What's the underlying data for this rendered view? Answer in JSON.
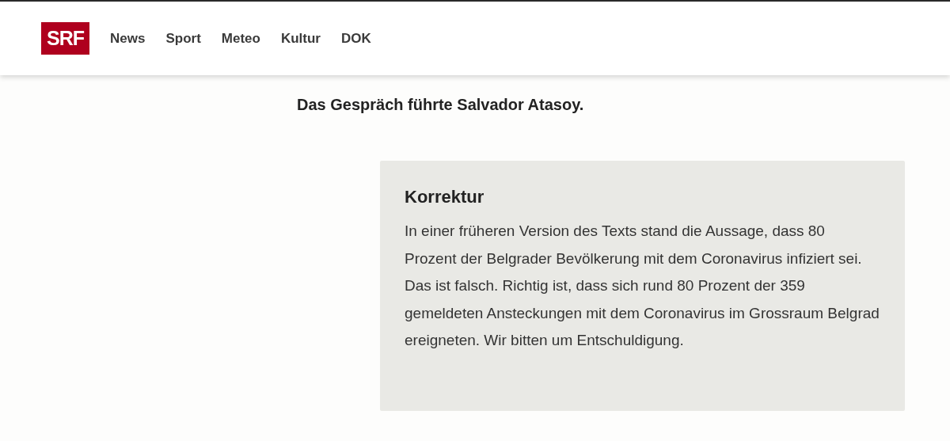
{
  "header": {
    "logo": "SRF",
    "nav": [
      "News",
      "Sport",
      "Meteo",
      "Kultur",
      "DOK"
    ]
  },
  "article": {
    "credit": "Das Gespräch führte Salvador Atasoy.",
    "correction": {
      "title": "Korrektur",
      "text": "In einer früheren Version des Texts stand die Aussage, dass 80 Prozent der Belgrader Bevölkerung mit dem Coronavirus infiziert sei. Das ist falsch. Richtig ist, dass sich rund 80 Prozent der 359 gemeldeten Ansteckungen mit dem Coronavirus im Grossraum Belgrad ereigneten. Wir bitten um Entschuldigung."
    }
  }
}
